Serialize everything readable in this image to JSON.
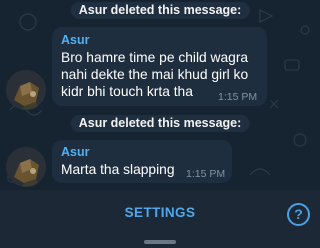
{
  "messages": [
    {
      "type": "service",
      "text": "Asur deleted this message:"
    },
    {
      "type": "message",
      "sender": "Asur",
      "lines": [
        "Bro hamre time pe child wagra",
        "nahi dekte the mai khud girl ko",
        "kidr bhi touch krta tha"
      ],
      "time": "1:15 PM"
    },
    {
      "type": "service",
      "text": "Asur deleted this message:"
    },
    {
      "type": "message",
      "sender": "Asur",
      "lines": [
        "Marta tha slapping"
      ],
      "time": "1:15 PM"
    }
  ],
  "bottom_bar": {
    "settings_label": "SETTINGS",
    "help_icon": "?"
  },
  "colors": {
    "background": "#162331",
    "bubble": "#1f2e3f",
    "sender": "#4fb0f4",
    "accent": "#50a8ea"
  }
}
